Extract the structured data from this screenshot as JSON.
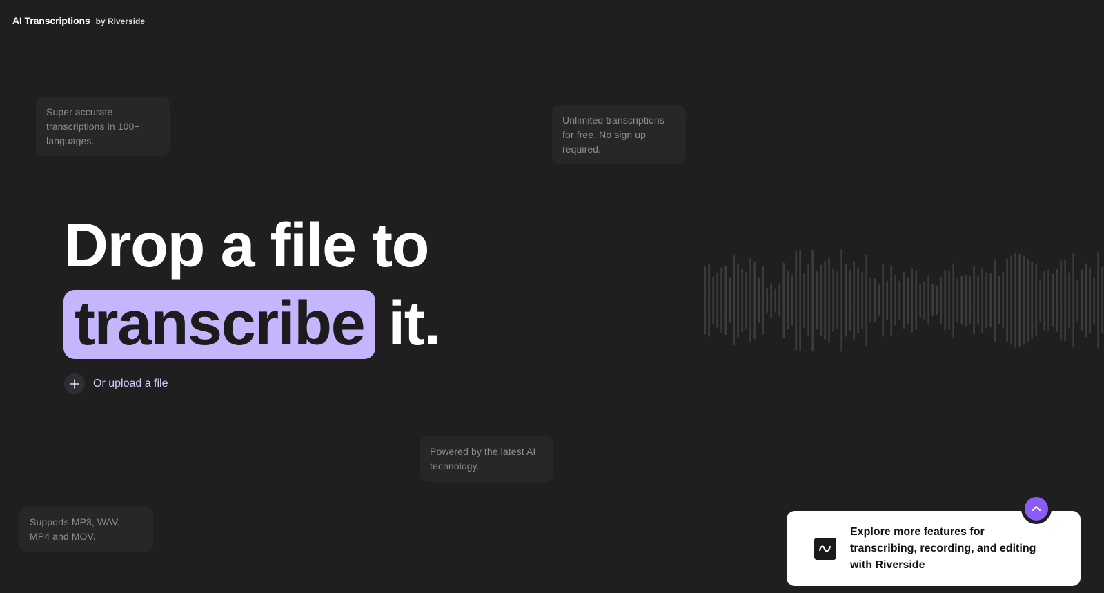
{
  "header": {
    "title": "AI Transcriptions",
    "subtitle": "by Riverside"
  },
  "features": {
    "accuracy": "Super accurate transcriptions in 100+ languages.",
    "free": "Unlimited transcriptions for free. No sign up required.",
    "ai": "Powered by the latest AI technology.",
    "formats": "Supports MP3, WAV, MP4 and MOV."
  },
  "hero": {
    "line1": "Drop a file to",
    "highlight": "transcribe",
    "tail": "it."
  },
  "upload": {
    "label": "Or upload a file",
    "icon": "plus-icon"
  },
  "promo": {
    "text": "Explore more features for transcribing, recording, and editing with Riverside",
    "icon": "riverside-logo-icon",
    "toggle_icon": "chevron-up-icon"
  },
  "colors": {
    "background": "#1f1f1f",
    "accent": "#c4b5fd",
    "toggle": "#8b5cf6",
    "card": "#272727"
  }
}
